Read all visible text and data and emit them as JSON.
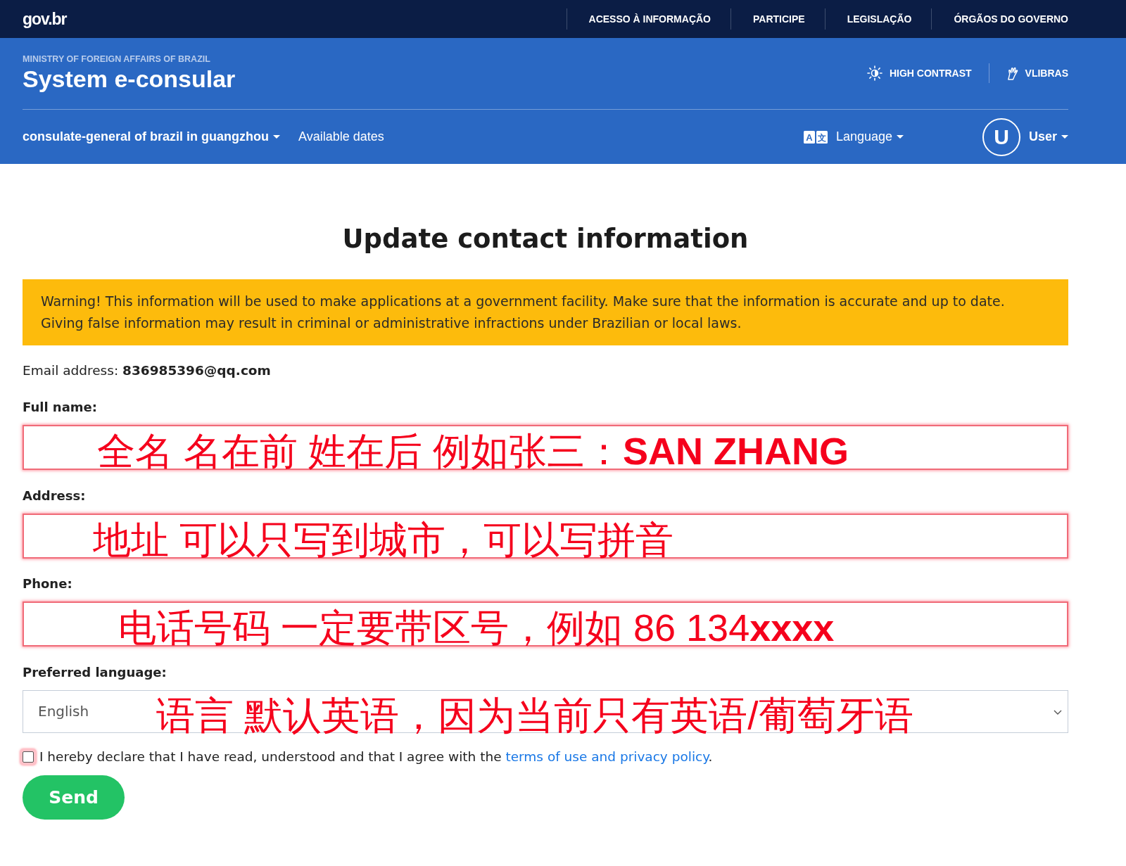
{
  "top_bar": {
    "logo": "gov.br",
    "links": [
      "ACESSO À INFORMAÇÃO",
      "PARTICIPE",
      "LEGISLAÇÃO",
      "ÓRGÃOS DO GOVERNO"
    ]
  },
  "header": {
    "ministry": "MINISTRY OF FOREIGN AFFAIRS OF BRAZIL",
    "title": "System e-consular",
    "tools": [
      {
        "kind": "contrast",
        "label": "HIGH CONTRAST"
      },
      {
        "kind": "sign_language",
        "label": "VLIBRAS"
      }
    ],
    "nav": {
      "consulate_menu": "consulate-general of brazil in guangzhou",
      "links": [
        "Available dates"
      ],
      "language_menu": {
        "icon_glyphs": [
          "A",
          "文"
        ],
        "label": "Language"
      },
      "user_menu": {
        "avatar_letter": "U",
        "label": "User"
      }
    }
  },
  "form": {
    "title": "Update contact information",
    "warning": [
      "Warning! This information will be used to make applications at a government facility. Make sure that the information is accurate and up to date.",
      "Giving false information may result in criminal or administrative infractions under Brazilian or local laws."
    ],
    "email": "Email address: **836985396@qq.com**",
    "fields": [
      {
        "kind": "text",
        "label": "Full name:",
        "highlighted": true,
        "annotation": "全名 名在前 姓在后 例如张三：**SAN ZHANG**"
      },
      {
        "kind": "text",
        "label": "Address:",
        "highlighted": true,
        "annotation": "地址 可以只写到城市，可以写拼音"
      },
      {
        "kind": "text",
        "label": "Phone:",
        "highlighted": true,
        "annotation": "电话号码 一定要带区号，例如 86 134**xxxx**"
      },
      {
        "kind": "select",
        "label": "Preferred language:",
        "value": "English",
        "highlighted": false,
        "annotation": "语言 默认英语，因为当前只有英语/葡萄牙语"
      }
    ],
    "agreement": {
      "checked": false,
      "highlighted": true,
      "text": "I hereby declare that I have read, understood and that I agree with the",
      "link": "terms of use and privacy policy",
      "end": "."
    },
    "send_button": "Send"
  }
}
